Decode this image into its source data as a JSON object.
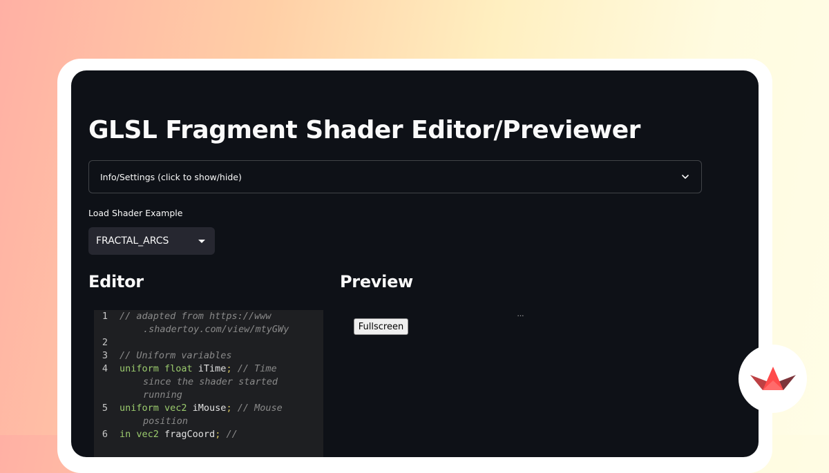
{
  "app": {
    "title": "GLSL Fragment Shader Editor/Previewer"
  },
  "expander": {
    "label": "Info/Settings (click to show/hide)",
    "expanded": false
  },
  "example_select": {
    "label": "Load Shader Example",
    "value": "FRACTAL_ARCS"
  },
  "editor": {
    "heading": "Editor",
    "lines": [
      {
        "number": "1",
        "tokens": [
          [
            "cm",
            "// adapted from https://www"
          ]
        ],
        "cont": [
          [
            [
              "cm",
              ".shadertoy.com/view/mtyGWy"
            ]
          ]
        ]
      },
      {
        "number": "2",
        "tokens": [],
        "cont": []
      },
      {
        "number": "3",
        "tokens": [
          [
            "cm",
            "// Uniform variables"
          ]
        ],
        "cont": []
      },
      {
        "number": "4",
        "tokens": [
          [
            "kw",
            "uniform float "
          ],
          [
            "id",
            "iTime"
          ],
          [
            "pn",
            "; "
          ],
          [
            "cm",
            "// Time"
          ]
        ],
        "cont": [
          [
            [
              "cm",
              "since the shader started"
            ]
          ],
          [
            [
              "cm",
              "running"
            ]
          ]
        ]
      },
      {
        "number": "5",
        "tokens": [
          [
            "kw",
            "uniform vec2 "
          ],
          [
            "id",
            "iMouse"
          ],
          [
            "pn",
            "; "
          ],
          [
            "cm",
            "// Mouse"
          ]
        ],
        "cont": [
          [
            [
              "cm",
              "position"
            ]
          ]
        ]
      },
      {
        "number": "6",
        "tokens": [
          [
            "kw",
            "in vec2 "
          ],
          [
            "id",
            "fragCoord"
          ],
          [
            "pn",
            "; "
          ],
          [
            "cm",
            "//"
          ]
        ],
        "cont": []
      }
    ]
  },
  "preview": {
    "heading": "Preview",
    "fullscreen_label": "Fullscreen",
    "menu_dots": "···"
  },
  "colors": {
    "background": "#0e1117",
    "select_bg": "#262730",
    "code_bg": "#1e1f22",
    "keyword": "#9ccc6e",
    "comment": "#8a8a8a",
    "punctuation": "#d4c45e",
    "brand_red": "#ff4b4b"
  },
  "icons": {
    "expander": "chevron-down-icon",
    "select": "caret-down-icon",
    "logo": "streamlit-logo"
  }
}
